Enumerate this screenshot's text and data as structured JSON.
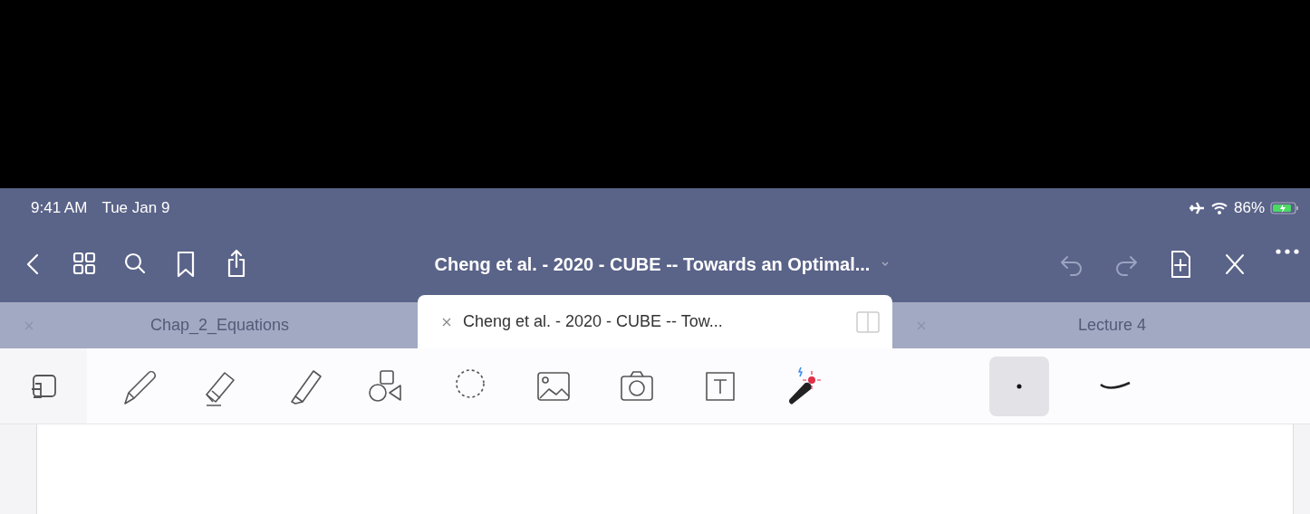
{
  "status_bar": {
    "time": "9:41 AM",
    "date": "Tue Jan 9",
    "battery": "86%"
  },
  "nav": {
    "title": "Cheng et al. - 2020 - CUBE -- Towards an Optimal...",
    "left_icons": [
      {
        "kind": "back"
      },
      {
        "kind": "grid"
      },
      {
        "kind": "search"
      },
      {
        "kind": "bookmark"
      },
      {
        "kind": "share"
      }
    ],
    "right_icons": [
      {
        "kind": "undo"
      },
      {
        "kind": "redo"
      },
      {
        "kind": "add-page"
      },
      {
        "kind": "close-pen"
      },
      {
        "kind": "more"
      }
    ]
  },
  "tabs": [
    {
      "label": "Chap_2_Equations",
      "selected": false
    },
    {
      "label": "Cheng et al. - 2020 - CUBE -- Tow...",
      "selected": true
    },
    {
      "label": "Lecture 4",
      "selected": false
    }
  ],
  "tools": [
    {
      "kind": "pen"
    },
    {
      "kind": "eraser"
    },
    {
      "kind": "highlighter"
    },
    {
      "kind": "shapes"
    },
    {
      "kind": "lasso"
    },
    {
      "kind": "image"
    },
    {
      "kind": "camera"
    },
    {
      "kind": "text"
    },
    {
      "kind": "laser"
    }
  ],
  "stroke_options": [
    {
      "kind": "dot",
      "selected": true
    },
    {
      "kind": "stroke",
      "selected": false
    }
  ]
}
